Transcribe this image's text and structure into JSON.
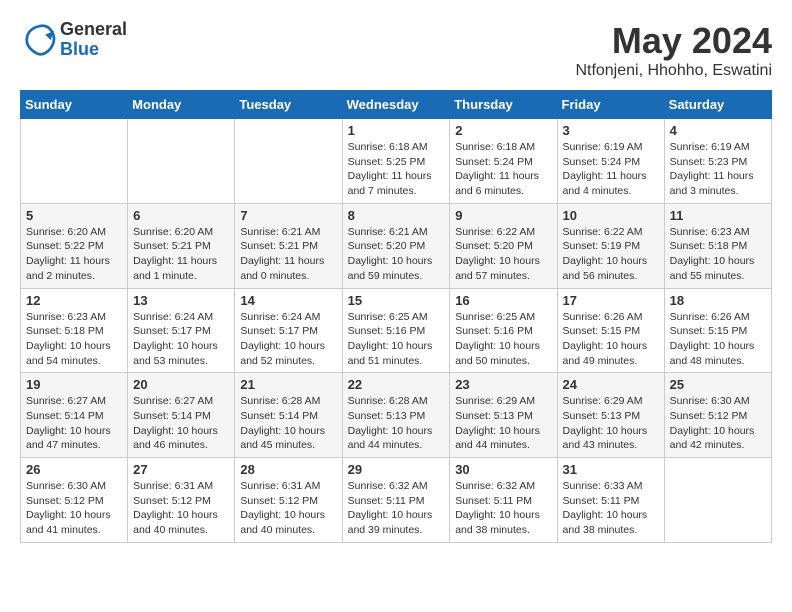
{
  "logo": {
    "general": "General",
    "blue": "Blue"
  },
  "title": "May 2024",
  "subtitle": "Ntfonjeni, Hhohho, Eswatini",
  "days_of_week": [
    "Sunday",
    "Monday",
    "Tuesday",
    "Wednesday",
    "Thursday",
    "Friday",
    "Saturday"
  ],
  "weeks": [
    [
      {
        "day": "",
        "info": ""
      },
      {
        "day": "",
        "info": ""
      },
      {
        "day": "",
        "info": ""
      },
      {
        "day": "1",
        "info": "Sunrise: 6:18 AM\nSunset: 5:25 PM\nDaylight: 11 hours\nand 7 minutes."
      },
      {
        "day": "2",
        "info": "Sunrise: 6:18 AM\nSunset: 5:24 PM\nDaylight: 11 hours\nand 6 minutes."
      },
      {
        "day": "3",
        "info": "Sunrise: 6:19 AM\nSunset: 5:24 PM\nDaylight: 11 hours\nand 4 minutes."
      },
      {
        "day": "4",
        "info": "Sunrise: 6:19 AM\nSunset: 5:23 PM\nDaylight: 11 hours\nand 3 minutes."
      }
    ],
    [
      {
        "day": "5",
        "info": "Sunrise: 6:20 AM\nSunset: 5:22 PM\nDaylight: 11 hours\nand 2 minutes."
      },
      {
        "day": "6",
        "info": "Sunrise: 6:20 AM\nSunset: 5:21 PM\nDaylight: 11 hours\nand 1 minute."
      },
      {
        "day": "7",
        "info": "Sunrise: 6:21 AM\nSunset: 5:21 PM\nDaylight: 11 hours\nand 0 minutes."
      },
      {
        "day": "8",
        "info": "Sunrise: 6:21 AM\nSunset: 5:20 PM\nDaylight: 10 hours\nand 59 minutes."
      },
      {
        "day": "9",
        "info": "Sunrise: 6:22 AM\nSunset: 5:20 PM\nDaylight: 10 hours\nand 57 minutes."
      },
      {
        "day": "10",
        "info": "Sunrise: 6:22 AM\nSunset: 5:19 PM\nDaylight: 10 hours\nand 56 minutes."
      },
      {
        "day": "11",
        "info": "Sunrise: 6:23 AM\nSunset: 5:18 PM\nDaylight: 10 hours\nand 55 minutes."
      }
    ],
    [
      {
        "day": "12",
        "info": "Sunrise: 6:23 AM\nSunset: 5:18 PM\nDaylight: 10 hours\nand 54 minutes."
      },
      {
        "day": "13",
        "info": "Sunrise: 6:24 AM\nSunset: 5:17 PM\nDaylight: 10 hours\nand 53 minutes."
      },
      {
        "day": "14",
        "info": "Sunrise: 6:24 AM\nSunset: 5:17 PM\nDaylight: 10 hours\nand 52 minutes."
      },
      {
        "day": "15",
        "info": "Sunrise: 6:25 AM\nSunset: 5:16 PM\nDaylight: 10 hours\nand 51 minutes."
      },
      {
        "day": "16",
        "info": "Sunrise: 6:25 AM\nSunset: 5:16 PM\nDaylight: 10 hours\nand 50 minutes."
      },
      {
        "day": "17",
        "info": "Sunrise: 6:26 AM\nSunset: 5:15 PM\nDaylight: 10 hours\nand 49 minutes."
      },
      {
        "day": "18",
        "info": "Sunrise: 6:26 AM\nSunset: 5:15 PM\nDaylight: 10 hours\nand 48 minutes."
      }
    ],
    [
      {
        "day": "19",
        "info": "Sunrise: 6:27 AM\nSunset: 5:14 PM\nDaylight: 10 hours\nand 47 minutes."
      },
      {
        "day": "20",
        "info": "Sunrise: 6:27 AM\nSunset: 5:14 PM\nDaylight: 10 hours\nand 46 minutes."
      },
      {
        "day": "21",
        "info": "Sunrise: 6:28 AM\nSunset: 5:14 PM\nDaylight: 10 hours\nand 45 minutes."
      },
      {
        "day": "22",
        "info": "Sunrise: 6:28 AM\nSunset: 5:13 PM\nDaylight: 10 hours\nand 44 minutes."
      },
      {
        "day": "23",
        "info": "Sunrise: 6:29 AM\nSunset: 5:13 PM\nDaylight: 10 hours\nand 44 minutes."
      },
      {
        "day": "24",
        "info": "Sunrise: 6:29 AM\nSunset: 5:13 PM\nDaylight: 10 hours\nand 43 minutes."
      },
      {
        "day": "25",
        "info": "Sunrise: 6:30 AM\nSunset: 5:12 PM\nDaylight: 10 hours\nand 42 minutes."
      }
    ],
    [
      {
        "day": "26",
        "info": "Sunrise: 6:30 AM\nSunset: 5:12 PM\nDaylight: 10 hours\nand 41 minutes."
      },
      {
        "day": "27",
        "info": "Sunrise: 6:31 AM\nSunset: 5:12 PM\nDaylight: 10 hours\nand 40 minutes."
      },
      {
        "day": "28",
        "info": "Sunrise: 6:31 AM\nSunset: 5:12 PM\nDaylight: 10 hours\nand 40 minutes."
      },
      {
        "day": "29",
        "info": "Sunrise: 6:32 AM\nSunset: 5:11 PM\nDaylight: 10 hours\nand 39 minutes."
      },
      {
        "day": "30",
        "info": "Sunrise: 6:32 AM\nSunset: 5:11 PM\nDaylight: 10 hours\nand 38 minutes."
      },
      {
        "day": "31",
        "info": "Sunrise: 6:33 AM\nSunset: 5:11 PM\nDaylight: 10 hours\nand 38 minutes."
      },
      {
        "day": "",
        "info": ""
      }
    ]
  ]
}
